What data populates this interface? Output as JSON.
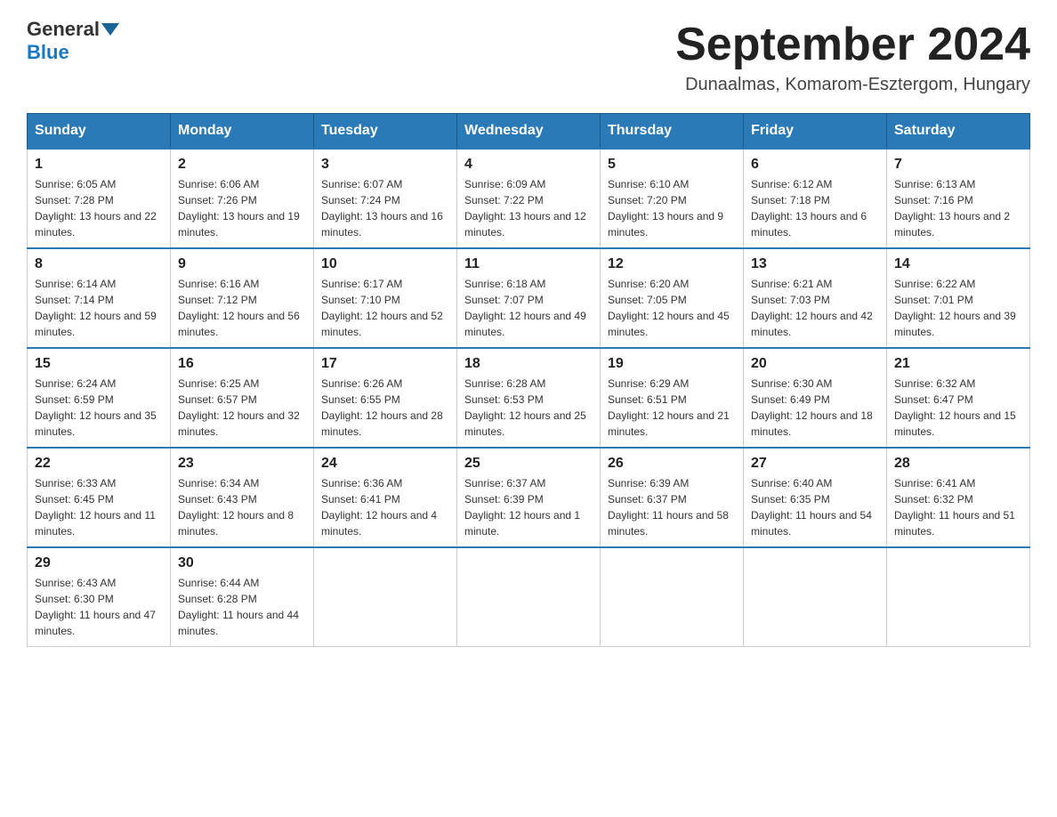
{
  "header": {
    "logo_general": "General",
    "logo_blue": "Blue",
    "month_title": "September 2024",
    "location": "Dunaalmas, Komarom-Esztergom, Hungary"
  },
  "weekdays": [
    "Sunday",
    "Monday",
    "Tuesday",
    "Wednesday",
    "Thursday",
    "Friday",
    "Saturday"
  ],
  "weeks": [
    [
      {
        "day": "1",
        "sunrise": "6:05 AM",
        "sunset": "7:28 PM",
        "daylight": "13 hours and 22 minutes."
      },
      {
        "day": "2",
        "sunrise": "6:06 AM",
        "sunset": "7:26 PM",
        "daylight": "13 hours and 19 minutes."
      },
      {
        "day": "3",
        "sunrise": "6:07 AM",
        "sunset": "7:24 PM",
        "daylight": "13 hours and 16 minutes."
      },
      {
        "day": "4",
        "sunrise": "6:09 AM",
        "sunset": "7:22 PM",
        "daylight": "13 hours and 12 minutes."
      },
      {
        "day": "5",
        "sunrise": "6:10 AM",
        "sunset": "7:20 PM",
        "daylight": "13 hours and 9 minutes."
      },
      {
        "day": "6",
        "sunrise": "6:12 AM",
        "sunset": "7:18 PM",
        "daylight": "13 hours and 6 minutes."
      },
      {
        "day": "7",
        "sunrise": "6:13 AM",
        "sunset": "7:16 PM",
        "daylight": "13 hours and 2 minutes."
      }
    ],
    [
      {
        "day": "8",
        "sunrise": "6:14 AM",
        "sunset": "7:14 PM",
        "daylight": "12 hours and 59 minutes."
      },
      {
        "day": "9",
        "sunrise": "6:16 AM",
        "sunset": "7:12 PM",
        "daylight": "12 hours and 56 minutes."
      },
      {
        "day": "10",
        "sunrise": "6:17 AM",
        "sunset": "7:10 PM",
        "daylight": "12 hours and 52 minutes."
      },
      {
        "day": "11",
        "sunrise": "6:18 AM",
        "sunset": "7:07 PM",
        "daylight": "12 hours and 49 minutes."
      },
      {
        "day": "12",
        "sunrise": "6:20 AM",
        "sunset": "7:05 PM",
        "daylight": "12 hours and 45 minutes."
      },
      {
        "day": "13",
        "sunrise": "6:21 AM",
        "sunset": "7:03 PM",
        "daylight": "12 hours and 42 minutes."
      },
      {
        "day": "14",
        "sunrise": "6:22 AM",
        "sunset": "7:01 PM",
        "daylight": "12 hours and 39 minutes."
      }
    ],
    [
      {
        "day": "15",
        "sunrise": "6:24 AM",
        "sunset": "6:59 PM",
        "daylight": "12 hours and 35 minutes."
      },
      {
        "day": "16",
        "sunrise": "6:25 AM",
        "sunset": "6:57 PM",
        "daylight": "12 hours and 32 minutes."
      },
      {
        "day": "17",
        "sunrise": "6:26 AM",
        "sunset": "6:55 PM",
        "daylight": "12 hours and 28 minutes."
      },
      {
        "day": "18",
        "sunrise": "6:28 AM",
        "sunset": "6:53 PM",
        "daylight": "12 hours and 25 minutes."
      },
      {
        "day": "19",
        "sunrise": "6:29 AM",
        "sunset": "6:51 PM",
        "daylight": "12 hours and 21 minutes."
      },
      {
        "day": "20",
        "sunrise": "6:30 AM",
        "sunset": "6:49 PM",
        "daylight": "12 hours and 18 minutes."
      },
      {
        "day": "21",
        "sunrise": "6:32 AM",
        "sunset": "6:47 PM",
        "daylight": "12 hours and 15 minutes."
      }
    ],
    [
      {
        "day": "22",
        "sunrise": "6:33 AM",
        "sunset": "6:45 PM",
        "daylight": "12 hours and 11 minutes."
      },
      {
        "day": "23",
        "sunrise": "6:34 AM",
        "sunset": "6:43 PM",
        "daylight": "12 hours and 8 minutes."
      },
      {
        "day": "24",
        "sunrise": "6:36 AM",
        "sunset": "6:41 PM",
        "daylight": "12 hours and 4 minutes."
      },
      {
        "day": "25",
        "sunrise": "6:37 AM",
        "sunset": "6:39 PM",
        "daylight": "12 hours and 1 minute."
      },
      {
        "day": "26",
        "sunrise": "6:39 AM",
        "sunset": "6:37 PM",
        "daylight": "11 hours and 58 minutes."
      },
      {
        "day": "27",
        "sunrise": "6:40 AM",
        "sunset": "6:35 PM",
        "daylight": "11 hours and 54 minutes."
      },
      {
        "day": "28",
        "sunrise": "6:41 AM",
        "sunset": "6:32 PM",
        "daylight": "11 hours and 51 minutes."
      }
    ],
    [
      {
        "day": "29",
        "sunrise": "6:43 AM",
        "sunset": "6:30 PM",
        "daylight": "11 hours and 47 minutes."
      },
      {
        "day": "30",
        "sunrise": "6:44 AM",
        "sunset": "6:28 PM",
        "daylight": "11 hours and 44 minutes."
      },
      null,
      null,
      null,
      null,
      null
    ]
  ]
}
